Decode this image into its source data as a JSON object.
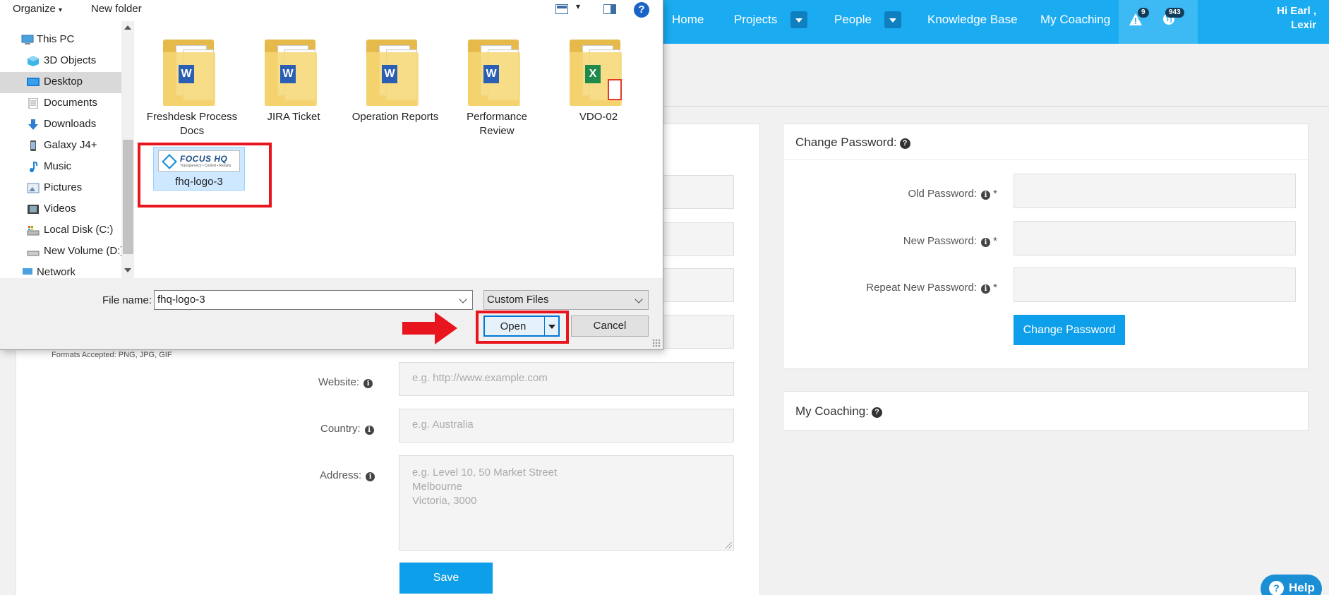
{
  "topnav": {
    "items": [
      {
        "label": "Home"
      },
      {
        "label": "Projects"
      },
      {
        "label": "People"
      },
      {
        "label": "Knowledge Base"
      },
      {
        "label": "My Coaching"
      }
    ],
    "alerts_badge": "9",
    "notifications_badge": "943",
    "greeting_line1": "Hi Earl ,",
    "greeting_line2": "Lexir",
    "bar_color": "#1aabf0"
  },
  "profile_form": {
    "formats_note": "Formats Accepted: PNG, JPG, GIF",
    "website_label": "Website:",
    "website_placeholder": "e.g. http://www.example.com",
    "country_label": "Country:",
    "country_placeholder": "e.g. Australia",
    "address_label": "Address:",
    "address_placeholder": "e.g. Level 10, 50 Market Street\nMelbourne\nVictoria, 3000",
    "save_label": "Save"
  },
  "change_password": {
    "title": "Change Password:",
    "old_label": "Old Password:",
    "new_label": "New Password:",
    "repeat_label": "Repeat New Password:",
    "required_mark": "*",
    "button_label": "Change Password"
  },
  "my_coaching": {
    "title": "My Coaching:"
  },
  "help_button": {
    "label": "Help"
  },
  "file_dialog": {
    "toolbar": {
      "organize_label": "Organize",
      "new_folder_label": "New folder",
      "help_glyph": "?"
    },
    "tree": [
      {
        "label": "This PC",
        "icon": "computer-icon"
      },
      {
        "label": "3D Objects",
        "icon": "cube-icon"
      },
      {
        "label": "Desktop",
        "icon": "desktop-icon",
        "selected": true
      },
      {
        "label": "Documents",
        "icon": "document-icon"
      },
      {
        "label": "Downloads",
        "icon": "download-icon"
      },
      {
        "label": "Galaxy J4+",
        "icon": "phone-icon"
      },
      {
        "label": "Music",
        "icon": "music-icon"
      },
      {
        "label": "Pictures",
        "icon": "pictures-icon"
      },
      {
        "label": "Videos",
        "icon": "video-icon"
      },
      {
        "label": "Local Disk (C:)",
        "icon": "disk-icon"
      },
      {
        "label": "New Volume (D:)",
        "icon": "drive-icon"
      },
      {
        "label": "Network",
        "icon": "network-icon"
      }
    ],
    "files": [
      {
        "name": "Freshdesk Process Docs",
        "type": "word-folder"
      },
      {
        "name": "JIRA Ticket",
        "type": "word-folder"
      },
      {
        "name": "Operation Reports",
        "type": "word-folder"
      },
      {
        "name": "Performance Review",
        "type": "word-folder"
      },
      {
        "name": "VDO-02",
        "type": "excel-folder"
      },
      {
        "name": "fhq-logo-3",
        "type": "image",
        "selected": true,
        "logo_text": "FOCUS HQ",
        "logo_tagline": "Transparency • Control • Results"
      }
    ],
    "file_name_label": "File name:",
    "file_name_value": "fhq-logo-3",
    "file_type_value": "Custom Files",
    "open_label": "Open",
    "cancel_label": "Cancel",
    "highlight_color": "#e8141e"
  }
}
